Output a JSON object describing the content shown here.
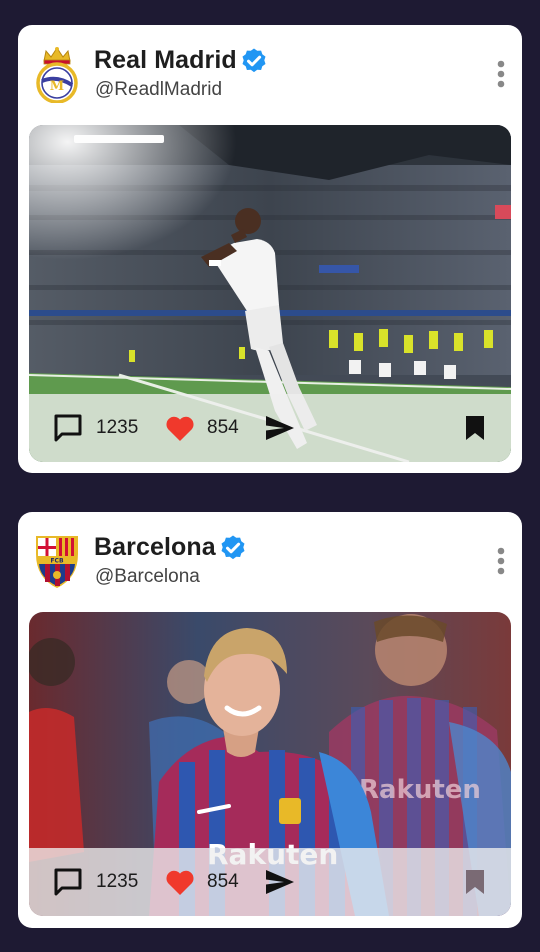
{
  "posts": [
    {
      "name": "Real Madrid",
      "handle": "@ReadlMadrid",
      "comments": "1235",
      "likes": "854",
      "icons": [
        "real-madrid-crest-icon",
        "verified-badge-icon",
        "more-vertical-icon",
        "comment-icon",
        "heart-icon",
        "send-icon",
        "bookmark-icon"
      ]
    },
    {
      "name": "Barcelona",
      "handle": "@Barcelona",
      "comments": "1235",
      "likes": "854",
      "icons": [
        "barcelona-crest-icon",
        "verified-badge-icon",
        "more-vertical-icon",
        "comment-icon",
        "heart-icon",
        "send-icon",
        "bookmark-icon"
      ]
    }
  ],
  "colors": {
    "background": "#1e1a33",
    "card": "#ffffff",
    "verified": "#2196f3",
    "heart": "#f0392c",
    "icon": "#111111"
  }
}
